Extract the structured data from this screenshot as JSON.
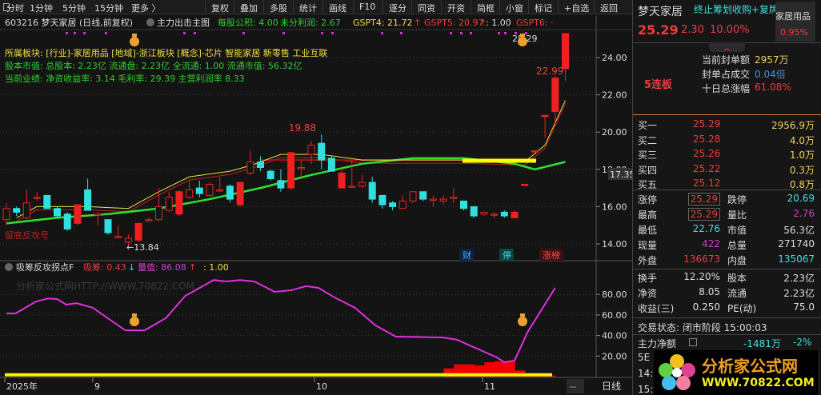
{
  "toolbar": {
    "items": [
      "分时",
      "1分钟",
      "5分钟",
      "15分钟",
      "更多 〉"
    ],
    "buttons": [
      "复权",
      "叠加",
      "多股",
      "统计",
      "画线",
      "F10",
      "逐分",
      "同资",
      "开资",
      "简框",
      "小窗",
      "标记",
      "+自选",
      "返回"
    ]
  },
  "main": {
    "title": "603216 梦天家居 (日线,前复权)",
    "indicator": "主力出击主图",
    "vals": [
      {
        "t": "每股公积: 4.00",
        "c": "#2ed02e"
      },
      {
        "t": "未分利润: 2.67",
        "c": "#2ed02e"
      },
      {
        "t": "GSPT4: 21.72",
        "c": "#f0e040"
      },
      {
        "t": "↑",
        "c": "#f03c3c"
      },
      {
        "t": "GSPT5: 20.97",
        "c": "#f03c3c"
      },
      {
        "t": "↑",
        "c": "#f03c3c"
      },
      {
        "t": ": 1.00",
        "c": "#ddd"
      },
      {
        "t": "GSPT6: ·",
        "c": "#f03c3c"
      }
    ],
    "info": [
      "所属板块: [行业]-家居用品 [地域]-浙江板块 [概念]-芯片 智能家居 新零售 工业互联",
      "股本市值: 总股本: 2.23亿 流通盘: 2.23亿 全流通: 1.00 流通市值: 56.32亿",
      "当前业绩:  净资收益率: 3.14 毛利率: 29.39 主营利润率 8.33"
    ],
    "yaxis": [
      "24.00",
      "22.00",
      "20.00",
      "18.00",
      "16.00",
      "14.00"
    ],
    "yticks": [
      24,
      22,
      20,
      18,
      16,
      14
    ],
    "current": "17.35",
    "high_label": "19.88",
    "low_label": "←13.84",
    "top_label": "25.29",
    "top2_label": "22.99",
    "signal_text": "留底反攻号",
    "markers": [
      "财",
      "停",
      "涨榜"
    ],
    "candles": [
      [
        15.3,
        15.9,
        16.2,
        15.0
      ],
      [
        15.9,
        15.7,
        16.0,
        15.5
      ],
      [
        15.4,
        16.2,
        16.9,
        15.3
      ],
      [
        16.5,
        16.5,
        16.8,
        16.3
      ],
      [
        16.6,
        15.9,
        16.6,
        15.9
      ],
      [
        15.9,
        15.5,
        16.0,
        15.4
      ],
      [
        15.6,
        14.8,
        15.7,
        14.7
      ],
      [
        15.1,
        16.1,
        16.1,
        15.0
      ],
      [
        16.9,
        15.8,
        17.5,
        15.8
      ],
      [
        15.6,
        15.6,
        15.7,
        15.0
      ],
      [
        15.3,
        14.6,
        15.3,
        14.5
      ],
      [
        14.4,
        14.4,
        15.0,
        14.3
      ],
      [
        14.1,
        14.3,
        14.5,
        13.84
      ],
      [
        14.2,
        15.1,
        15.1,
        14.1
      ],
      [
        15.3,
        15.3,
        15.4,
        15.2
      ],
      [
        15.3,
        16.0,
        17.0,
        15.2
      ],
      [
        15.8,
        16.5,
        16.8,
        15.7
      ],
      [
        15.6,
        16.8,
        16.9,
        15.5
      ],
      [
        16.5,
        16.9,
        17.4,
        16.4
      ],
      [
        17.0,
        16.7,
        17.4,
        16.5
      ],
      [
        16.6,
        17.2,
        17.3,
        16.5
      ],
      [
        16.9,
        16.9,
        17.6,
        16.8
      ],
      [
        17.1,
        16.4,
        17.2,
        16.2
      ],
      [
        16.1,
        17.3,
        17.3,
        16.0
      ],
      [
        17.8,
        18.4,
        19.0,
        17.7
      ],
      [
        18.4,
        18.1,
        18.7,
        17.9
      ],
      [
        17.9,
        17.5,
        18.0,
        17.4
      ],
      [
        17.4,
        17.0,
        18.0,
        16.8
      ],
      [
        17.0,
        18.9,
        18.9,
        16.9
      ],
      [
        18.1,
        18.1,
        18.5,
        17.6
      ],
      [
        18.8,
        19.3,
        19.5,
        18.3
      ],
      [
        19.4,
        18.5,
        19.88,
        18.0
      ],
      [
        18.6,
        17.9,
        18.7,
        17.9
      ],
      [
        17.0,
        17.8,
        18.1,
        17.0
      ],
      [
        17.1,
        17.1,
        18.5,
        17.0
      ],
      [
        17.1,
        17.3,
        17.7,
        17.0
      ],
      [
        17.3,
        16.4,
        17.6,
        16.2
      ],
      [
        16.6,
        16.1,
        16.6,
        15.9
      ],
      [
        16.2,
        16.0,
        16.3,
        15.8
      ],
      [
        15.9,
        16.3,
        16.6,
        15.9
      ],
      [
        16.3,
        16.8,
        16.8,
        16.2
      ],
      [
        16.8,
        16.4,
        16.8,
        16.3
      ],
      [
        16.4,
        16.4,
        16.6,
        16.0
      ],
      [
        16.3,
        16.4,
        16.6,
        16.1
      ],
      [
        16.5,
        16.5,
        17.0,
        16.2
      ],
      [
        16.3,
        15.9,
        16.3,
        15.8
      ],
      [
        16.0,
        15.5,
        16.0,
        15.4
      ],
      [
        15.6,
        15.7,
        15.7,
        15.5
      ],
      [
        15.6,
        15.6,
        15.7,
        15.4
      ],
      [
        15.7,
        15.5,
        15.8,
        15.4
      ],
      [
        15.4,
        15.7,
        15.8,
        15.4
      ],
      [
        17.2,
        17.2,
        17.2,
        17.2
      ],
      [
        19.0,
        19.0,
        19.0,
        19.0
      ],
      [
        20.9,
        20.9,
        20.9,
        19.7
      ],
      [
        21.1,
        22.9,
        22.99,
        20.3
      ],
      [
        23.4,
        25.29,
        25.29,
        22.76
      ]
    ],
    "ma_green": [
      [
        0,
        15.1
      ],
      [
        5,
        15.4
      ],
      [
        10,
        15.6
      ],
      [
        15,
        15.9
      ],
      [
        20,
        16.4
      ],
      [
        25,
        17.0
      ],
      [
        30,
        17.7
      ],
      [
        35,
        18.3
      ],
      [
        40,
        18.6
      ],
      [
        45,
        18.6
      ],
      [
        50,
        18.3
      ],
      [
        52,
        18.0
      ],
      [
        55,
        18.4
      ]
    ],
    "ma_yellow": [
      [
        1,
        15.4
      ],
      [
        3,
        16.0
      ],
      [
        8,
        16.0
      ],
      [
        12,
        15.9
      ],
      [
        15,
        16.8
      ],
      [
        18,
        17.6
      ],
      [
        22,
        17.9
      ],
      [
        24,
        18.2
      ],
      [
        27,
        18.8
      ],
      [
        31,
        18.8
      ],
      [
        35,
        18.5
      ],
      [
        45,
        18.5
      ],
      [
        51,
        18.4
      ],
      [
        53,
        19.3
      ],
      [
        55,
        21.7
      ]
    ]
  },
  "indicator": {
    "name": "吸筹反攻拐点F",
    "v1": "吸筹: 0.43",
    "v1arrow": "↓",
    "v2": "量值: 86.08",
    "v2arrow": "↑",
    "v3": ": 1.00",
    "watermark": "分析家公式网HTTP://WWW.70822.COM",
    "yaxis": [
      "80.00",
      "60.00",
      "40.00",
      "20.00"
    ],
    "yticks": [
      80,
      60,
      40,
      20
    ],
    "line": [
      [
        0,
        61.5
      ],
      [
        0.9,
        61.5
      ],
      [
        2.9,
        73
      ],
      [
        4.1,
        76
      ],
      [
        5,
        75.5
      ],
      [
        5.9,
        70
      ],
      [
        6.9,
        71.5
      ],
      [
        8.5,
        67
      ],
      [
        11.7,
        45
      ],
      [
        13.6,
        45
      ],
      [
        15.7,
        57
      ],
      [
        17.6,
        78.6
      ],
      [
        20.4,
        94
      ],
      [
        21.6,
        92.6
      ],
      [
        23,
        94
      ],
      [
        24.4,
        92.6
      ],
      [
        26.4,
        82.5
      ],
      [
        28,
        84
      ],
      [
        29.5,
        88
      ],
      [
        30.7,
        86.4
      ],
      [
        32.3,
        77
      ],
      [
        34.3,
        67
      ],
      [
        36.3,
        50
      ],
      [
        38.3,
        39
      ],
      [
        43,
        38
      ],
      [
        44.3,
        36
      ],
      [
        48.2,
        19
      ],
      [
        49,
        14
      ],
      [
        50,
        15.6
      ],
      [
        51.3,
        43.6
      ],
      [
        54,
        86.4
      ]
    ],
    "bars": [
      [
        43.5,
        8
      ],
      [
        44.5,
        12
      ],
      [
        45.5,
        12
      ],
      [
        46.5,
        11
      ],
      [
        47.5,
        14
      ],
      [
        48.5,
        15
      ],
      [
        49.5,
        15
      ],
      [
        50.5,
        6
      ],
      [
        51.5,
        3
      ],
      [
        52.5,
        1
      ],
      [
        53.5,
        1
      ]
    ],
    "baseline": 1.0
  },
  "xaxis": {
    "labels": [
      "2025年",
      "9",
      "10",
      "11"
    ],
    "dash": "--",
    "period": "日线"
  },
  "quote": {
    "name": "梦天家居",
    "news": "终止筹划收购+复牌",
    "industry": "家居用品",
    "industry_pct": "0.95%",
    "price": "25.29",
    "change": "2.30",
    "pct": "10.00%",
    "board": "5连板",
    "seal_label": "当前封单额",
    "seal": "2957万",
    "ratio_label": "封单占成交",
    "ratio": "0.04倍",
    "ten_label": "十日总涨幅",
    "ten": "61.08%",
    "bids": [
      {
        "l": "买一",
        "p": "25.29",
        "v": "2956.9万"
      },
      {
        "l": "买二",
        "p": "25.28",
        "v": "4.0万"
      },
      {
        "l": "买三",
        "p": "25.26",
        "v": "1.0万"
      },
      {
        "l": "买四",
        "p": "25.22",
        "v": "0.3万"
      },
      {
        "l": "买五",
        "p": "25.12",
        "v": "0.8万"
      }
    ],
    "stats": [
      [
        "涨停",
        "25.29",
        "跌停",
        "20.69"
      ],
      [
        "最高",
        "25.29",
        "量比",
        "2.76"
      ],
      [
        "最低",
        "22.76",
        "市值",
        "56.3亿"
      ],
      [
        "现量",
        "422",
        "总量",
        "271740"
      ],
      [
        "外盘",
        "136673",
        "内盘",
        "135067"
      ]
    ],
    "stats2": [
      [
        "换手",
        "12.20%",
        "股本",
        "2.23亿"
      ],
      [
        "净资",
        "8.05",
        "流通",
        "2.23亿"
      ],
      [
        "收益(三)",
        "0.250",
        "PE(动)",
        "75.0"
      ]
    ],
    "status": "交易状态: 闭市阶段 15:00:03",
    "flow_label": "主力净额",
    "flow": "-1481万",
    "flow_pct": "-2%",
    "row5": "5E",
    "t1": "14:",
    "t2": "15:",
    "logo_text": "分析家公式网",
    "logo_url": "WWW.70822.COM"
  }
}
